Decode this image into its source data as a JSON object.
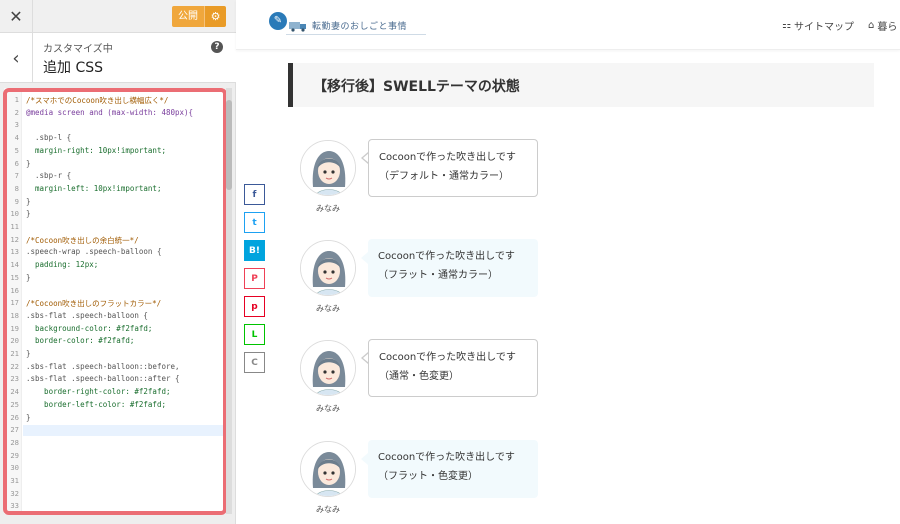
{
  "sidebar": {
    "close_icon": "✕",
    "publish_label": "公開",
    "gear_icon": "⚙",
    "back_icon": "‹",
    "breadcrumb": "カスタマイズ中",
    "section_title": "追加 CSS",
    "help_icon": "?"
  },
  "editor": {
    "line_numbers": [
      "1",
      "2",
      "3",
      "4",
      "5",
      "6",
      "7",
      "8",
      "9",
      "10",
      "11",
      "12",
      "13",
      "14",
      "15",
      "16",
      "17",
      "18",
      "19",
      "20",
      "21",
      "22",
      "23",
      "24",
      "25",
      "26",
      "27",
      "28",
      "29",
      "30",
      "31",
      "32",
      "33"
    ],
    "lines": [
      "/*スマホでのCocoon吹き出し横幅広く*/",
      "@media screen and (max-width: 480px){",
      "",
      "  .sbp-l {",
      "  margin-right: 10px!important;",
      "}",
      "  .sbp-r {",
      "  margin-left: 10px!important;",
      "}",
      "}",
      "",
      "/*Cocoon吹き出しの余白統一*/",
      ".speech-wrap .speech-balloon {",
      "  padding: 12px;",
      "}",
      "",
      "/*Cocoon吹き出しのフラットカラー*/",
      ".sbs-flat .speech-balloon {",
      "  background-color: #f2fafd;",
      "  border-color: #f2fafd;",
      "}",
      ".sbs-flat .speech-balloon::before,",
      ".sbs-flat .speech-balloon::after {",
      "    border-right-color: #f2fafd;",
      "    border-left-color: #f2fafd;",
      "}",
      "",
      "",
      "",
      "",
      "",
      "",
      ""
    ]
  },
  "site": {
    "logo_text": "転勤妻のおしごと事情",
    "nav_sitemap": "サイトマップ",
    "nav_other": "暮ら",
    "heading": "【移行後】SWELLテーマの状態"
  },
  "share": [
    "f",
    "t",
    "B!",
    "P",
    "p",
    "L",
    "C"
  ],
  "balloons": [
    {
      "name": "みなみ",
      "line1": "Cocoonで作った吹き出しです",
      "line2": "（デフォルト・通常カラー）",
      "style": "border"
    },
    {
      "name": "みなみ",
      "line1": "Cocoonで作った吹き出しです",
      "line2": "（フラット・通常カラー）",
      "style": "flat"
    },
    {
      "name": "みなみ",
      "line1": "Cocoonで作った吹き出しです",
      "line2": "（通常・色変更）",
      "style": "border"
    },
    {
      "name": "みなみ",
      "line1": "Cocoonで作った吹き出しです",
      "line2": "（フラット・色変更）",
      "style": "flat"
    }
  ],
  "colors": {
    "accent_publish": "#f0a73c",
    "highlight_border": "#eb6d74",
    "flat_balloon": "#f2fafd",
    "facebook": "#3b5998",
    "twitter": "#1da1f2",
    "hatena": "#00a4de",
    "pocket": "#ef4056",
    "pinterest": "#e60023",
    "line": "#00c300"
  }
}
